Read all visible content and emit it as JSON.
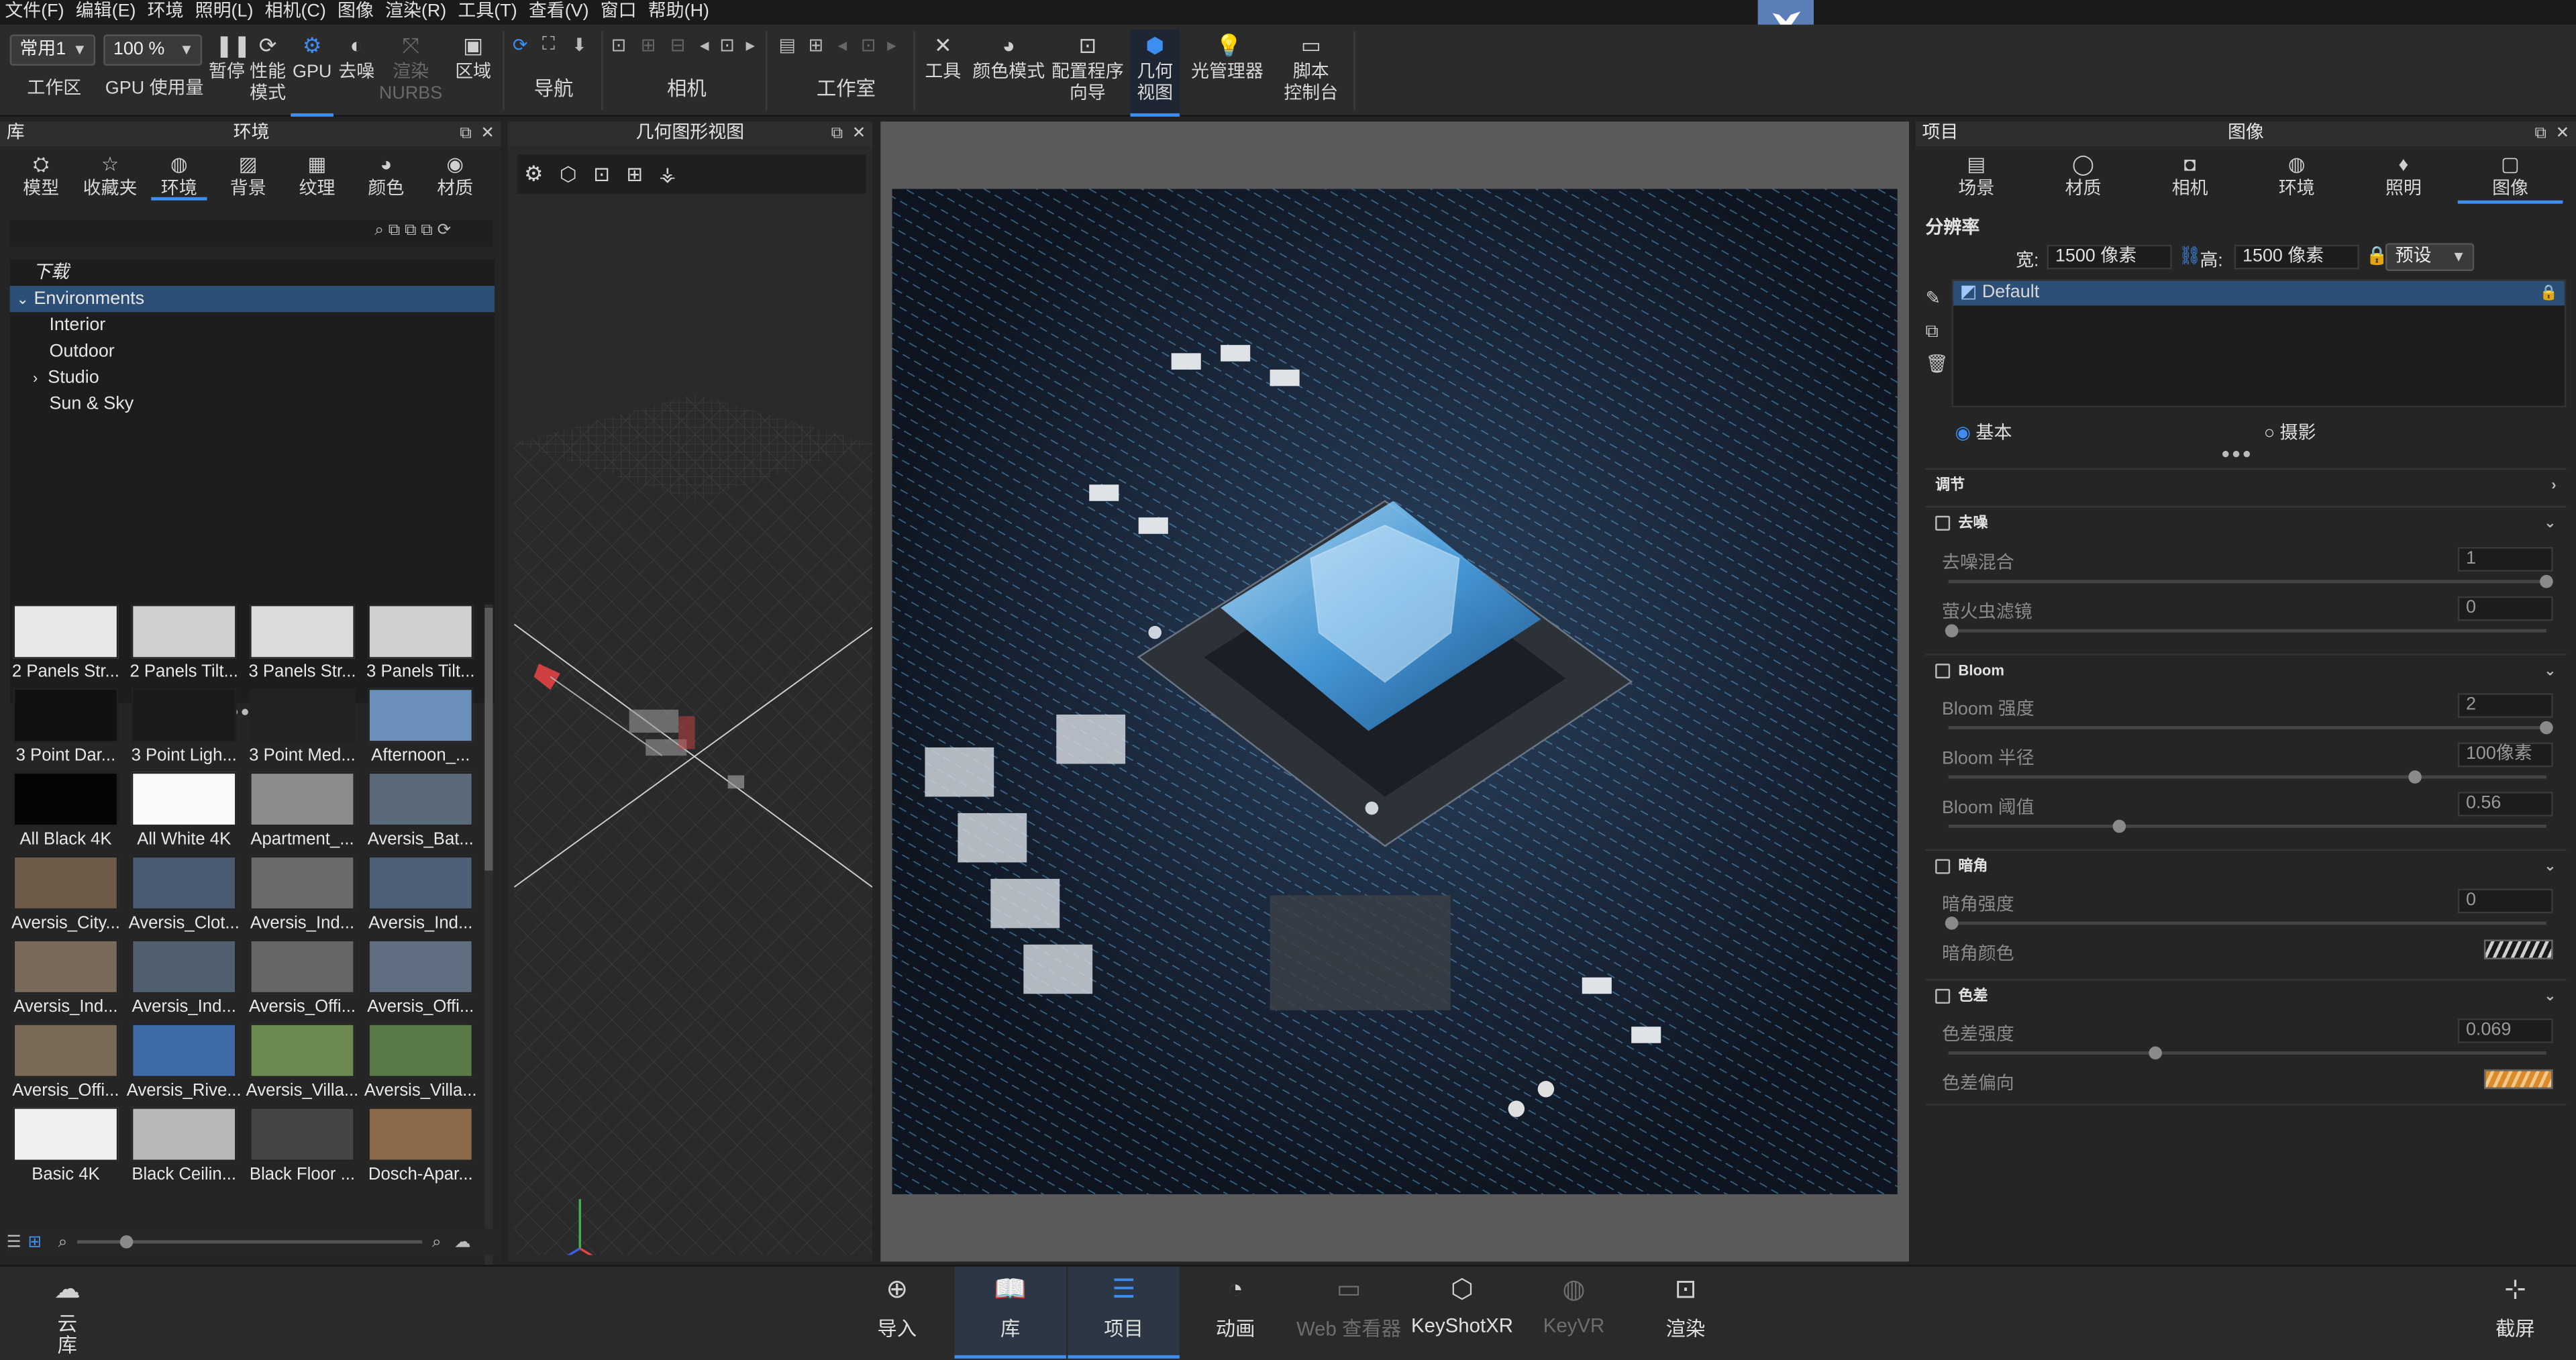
{
  "menu": [
    "文件(F)",
    "编辑(E)",
    "环境",
    "照明(L)",
    "相机(C)",
    "图像",
    "渲染(R)",
    "工具(T)",
    "查看(V)",
    "窗口",
    "帮助(H)"
  ],
  "toolbar": {
    "workspace_select": "常用1",
    "workspace_label": "工作区",
    "zoom_select": "100 %",
    "gpu_usage": "GPU 使用量",
    "pause": "暂停",
    "performance": "性能\n模式",
    "gpu": "GPU",
    "denoise": "去噪",
    "render_nurbs": "渲染\nNURBS",
    "region": "区域",
    "navigation": "导航",
    "camera": "相机",
    "studio": "工作室",
    "tools": "工具",
    "color_mode": "颜色模式",
    "config_wizard": "配置程序\n向导",
    "geometry_view": "几何\n视图",
    "light_manager": "光管理器",
    "script_console": "脚本\n控制台"
  },
  "library": {
    "title": "库",
    "subtitle": "环境",
    "tabs": [
      "模型",
      "收藏夹",
      "环境",
      "背景",
      "纹理",
      "颜色",
      "材质"
    ],
    "tree": {
      "downloads": "下载",
      "root": "Environments",
      "children": [
        "Interior",
        "Outdoor",
        "Studio",
        "Sun & Sky"
      ]
    },
    "thumbs": [
      "2 Panels Str...",
      "2 Panels Tilt...",
      "3 Panels Str...",
      "3 Panels Tilt...",
      "3 Point Dar...",
      "3 Point Ligh...",
      "3 Point Med...",
      "Afternoon_...",
      "All Black 4K",
      "All White 4K",
      "Apartment_...",
      "Aversis_Bat...",
      "Aversis_City...",
      "Aversis_Clot...",
      "Aversis_Ind...",
      "Aversis_Ind...",
      "Aversis_Ind...",
      "Aversis_Ind...",
      "Aversis_Offi...",
      "Aversis_Offi...",
      "Aversis_Offi...",
      "Aversis_Rive...",
      "Aversis_Villa...",
      "Aversis_Villa...",
      "Basic 4K",
      "Black Ceilin...",
      "Black Floor ...",
      "Dosch-Apar..."
    ]
  },
  "geometry_view": {
    "title": "几何图形视图"
  },
  "project": {
    "title": "项目",
    "subtitle": "图像",
    "tabs": [
      "场景",
      "材质",
      "相机",
      "环境",
      "照明",
      "图像"
    ],
    "resolution_label": "分辨率",
    "width_label": "宽:",
    "width_value": "1500 像素",
    "height_label": "高:",
    "height_value": "1500 像素",
    "preset": "预设",
    "list_item": "Default",
    "mode_basic": "基本",
    "mode_photo": "摄影",
    "adjust": "调节",
    "denoise": {
      "header": "去噪",
      "blend_label": "去噪混合",
      "blend_value": "1",
      "firefly_label": "萤火虫滤镜",
      "firefly_value": "0"
    },
    "bloom": {
      "header": "Bloom",
      "intensity_label": "Bloom 强度",
      "intensity_value": "2",
      "radius_label": "Bloom 半径",
      "radius_value": "100像素",
      "threshold_label": "Bloom 阈值",
      "threshold_value": "0.56"
    },
    "vignette": {
      "header": "暗角",
      "strength_label": "暗角强度",
      "strength_value": "0",
      "color_label": "暗角颜色"
    },
    "chromatic": {
      "header": "色差",
      "strength_label": "色差强度",
      "strength_value": "0.069",
      "shift_label": "色差偏向"
    }
  },
  "bottom": {
    "cloud": "云\n库",
    "import": "导入",
    "library": "库",
    "project": "项目",
    "animation": "动画",
    "web_viewer": "Web 查看器",
    "keyshotxr": "KeyShotXR",
    "keyvr": "KeyVR",
    "render": "渲染",
    "screenshot": "截屏"
  },
  "colors": {
    "accent": "#3d8ef0",
    "bg": "#232323"
  }
}
